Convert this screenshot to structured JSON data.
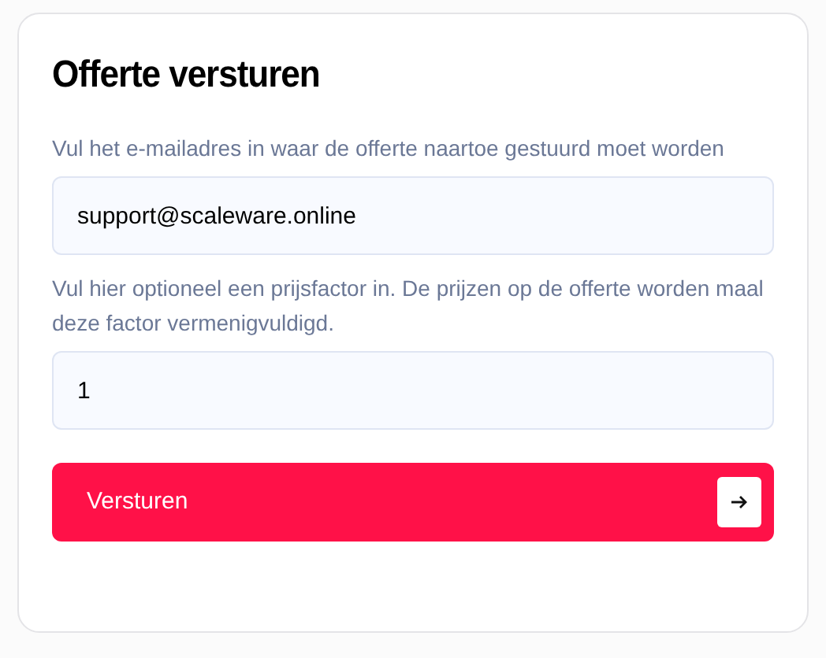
{
  "form": {
    "title": "Offerte versturen",
    "fields": [
      {
        "label": "Vul het e-mailadres in waar de offerte naartoe gestuurd moet worden",
        "value": "support@scaleware.online"
      },
      {
        "label": "Vul hier optioneel een prijsfactor in. De prijzen op de offerte worden maal deze factor vermenigvuldigd.",
        "value": "1"
      }
    ],
    "submit": {
      "label": "Versturen"
    }
  }
}
